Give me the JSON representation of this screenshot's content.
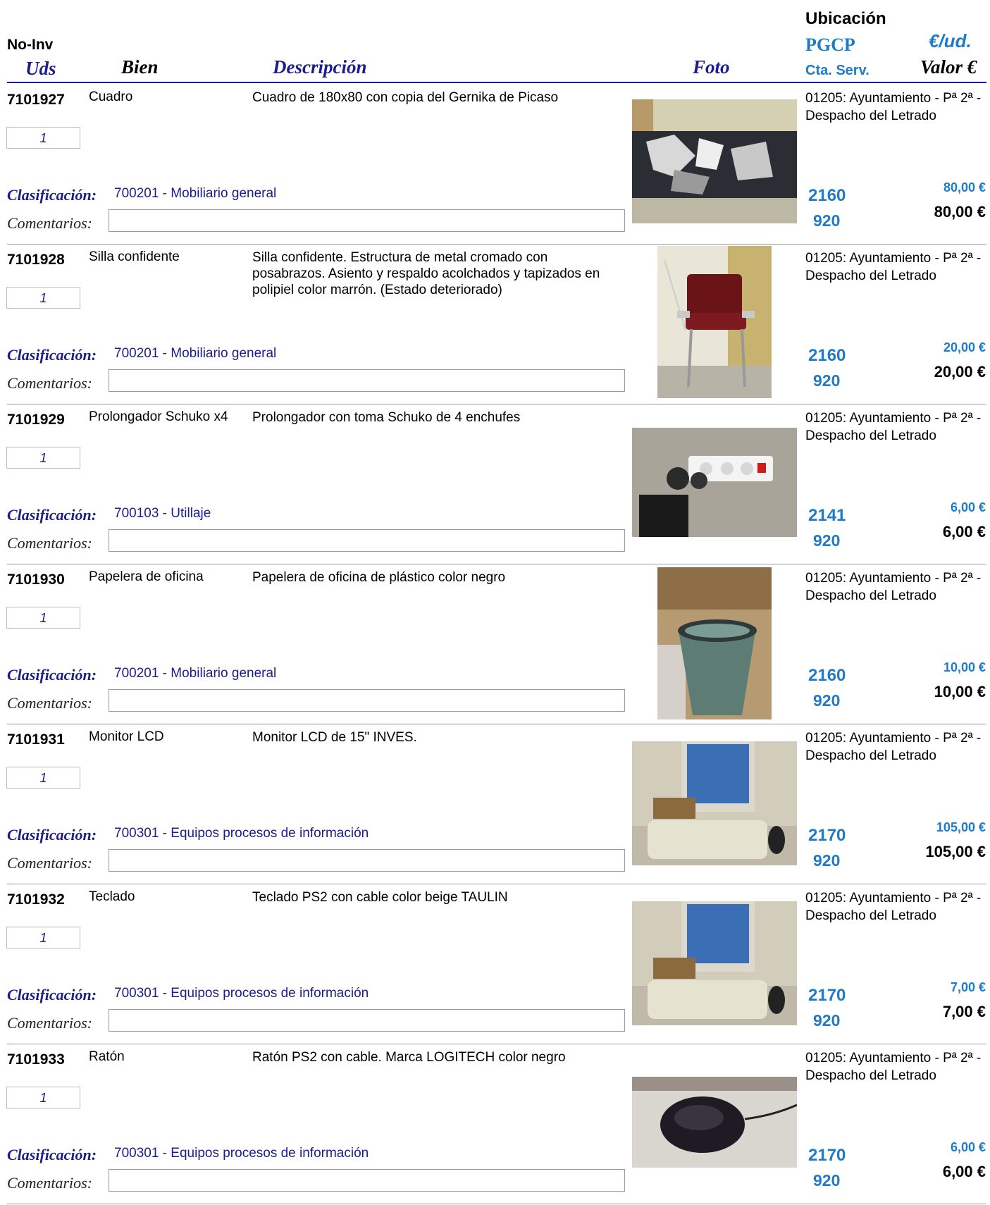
{
  "header": {
    "no_inv": "No-Inv",
    "uds": "Uds",
    "bien": "Bien",
    "descripcion": "Descripción",
    "foto": "Foto",
    "ubicacion": "Ubicación",
    "pgcp": "PGCP",
    "cta_serv": "Cta. Serv.",
    "eur_ud": "€/ud.",
    "valor": "Valor €"
  },
  "labels": {
    "clasificacion": "Clasificación:",
    "comentarios": "Comentarios:"
  },
  "items": [
    {
      "no_inv": "7101927",
      "bien": "Cuadro",
      "descripcion": "Cuadro de 180x80 con copia del Gernika de Picaso",
      "uds": "1",
      "clasificacion": "700201 - Mobiliario general",
      "ubicacion": "01205: Ayuntamiento - Pª 2ª - Despacho del Letrado",
      "pgcp": "2160",
      "cta": "920",
      "eur_ud": "80,00 €",
      "valor": "80,00 €",
      "comentarios": "",
      "photo": "painting-photo"
    },
    {
      "no_inv": "7101928",
      "bien": "Silla confidente",
      "descripcion": "Silla confidente. Estructura de metal cromado con posabrazos. Asiento y respaldo acolchados y tapizados en polipiel color marrón. (Estado deteriorado)",
      "uds": "1",
      "clasificacion": "700201 - Mobiliario general",
      "ubicacion": "01205: Ayuntamiento - Pª 2ª - Despacho del Letrado",
      "pgcp": "2160",
      "cta": "920",
      "eur_ud": "20,00 €",
      "valor": "20,00 €",
      "comentarios": "",
      "photo": "chair-photo"
    },
    {
      "no_inv": "7101929",
      "bien": "Prolongador Schuko x4",
      "descripcion": "Prolongador con toma  Schuko  de 4 enchufes",
      "uds": "1",
      "clasificacion": "700103 - Utillaje",
      "ubicacion": "01205: Ayuntamiento - Pª 2ª - Despacho del Letrado",
      "pgcp": "2141",
      "cta": "920",
      "eur_ud": "6,00 €",
      "valor": "6,00 €",
      "comentarios": "",
      "photo": "power-strip-photo"
    },
    {
      "no_inv": "7101930",
      "bien": "Papelera de oficina",
      "descripcion": "Papelera de oficina de plástico color negro",
      "uds": "1",
      "clasificacion": "700201 - Mobiliario general",
      "ubicacion": "01205: Ayuntamiento - Pª 2ª - Despacho del Letrado",
      "pgcp": "2160",
      "cta": "920",
      "eur_ud": "10,00 €",
      "valor": "10,00 €",
      "comentarios": "",
      "photo": "wastebasket-photo"
    },
    {
      "no_inv": "7101931",
      "bien": "Monitor LCD",
      "descripcion": "Monitor LCD de 15\" INVES.",
      "uds": "1",
      "clasificacion": "700301 - Equipos procesos de información",
      "ubicacion": "01205: Ayuntamiento - Pª 2ª - Despacho del Letrado",
      "pgcp": "2170",
      "cta": "920",
      "eur_ud": "105,00 €",
      "valor": "105,00 €",
      "comentarios": "",
      "photo": "monitor-photo"
    },
    {
      "no_inv": "7101932",
      "bien": "Teclado",
      "descripcion": "Teclado PS2 con cable color beige TAULIN",
      "uds": "1",
      "clasificacion": "700301 - Equipos procesos de información",
      "ubicacion": "01205: Ayuntamiento - Pª 2ª - Despacho del Letrado",
      "pgcp": "2170",
      "cta": "920",
      "eur_ud": "7,00 €",
      "valor": "7,00 €",
      "comentarios": "",
      "photo": "keyboard-photo"
    },
    {
      "no_inv": "7101933",
      "bien": "Ratón",
      "descripcion": "Ratón PS2 con cable. Marca LOGITECH  color negro",
      "uds": "1",
      "clasificacion": "700301 - Equipos procesos de información",
      "ubicacion": "01205: Ayuntamiento - Pª 2ª - Despacho del Letrado",
      "pgcp": "2170",
      "cta": "920",
      "eur_ud": "6,00 €",
      "valor": "6,00 €",
      "comentarios": "",
      "photo": "mouse-photo"
    }
  ]
}
